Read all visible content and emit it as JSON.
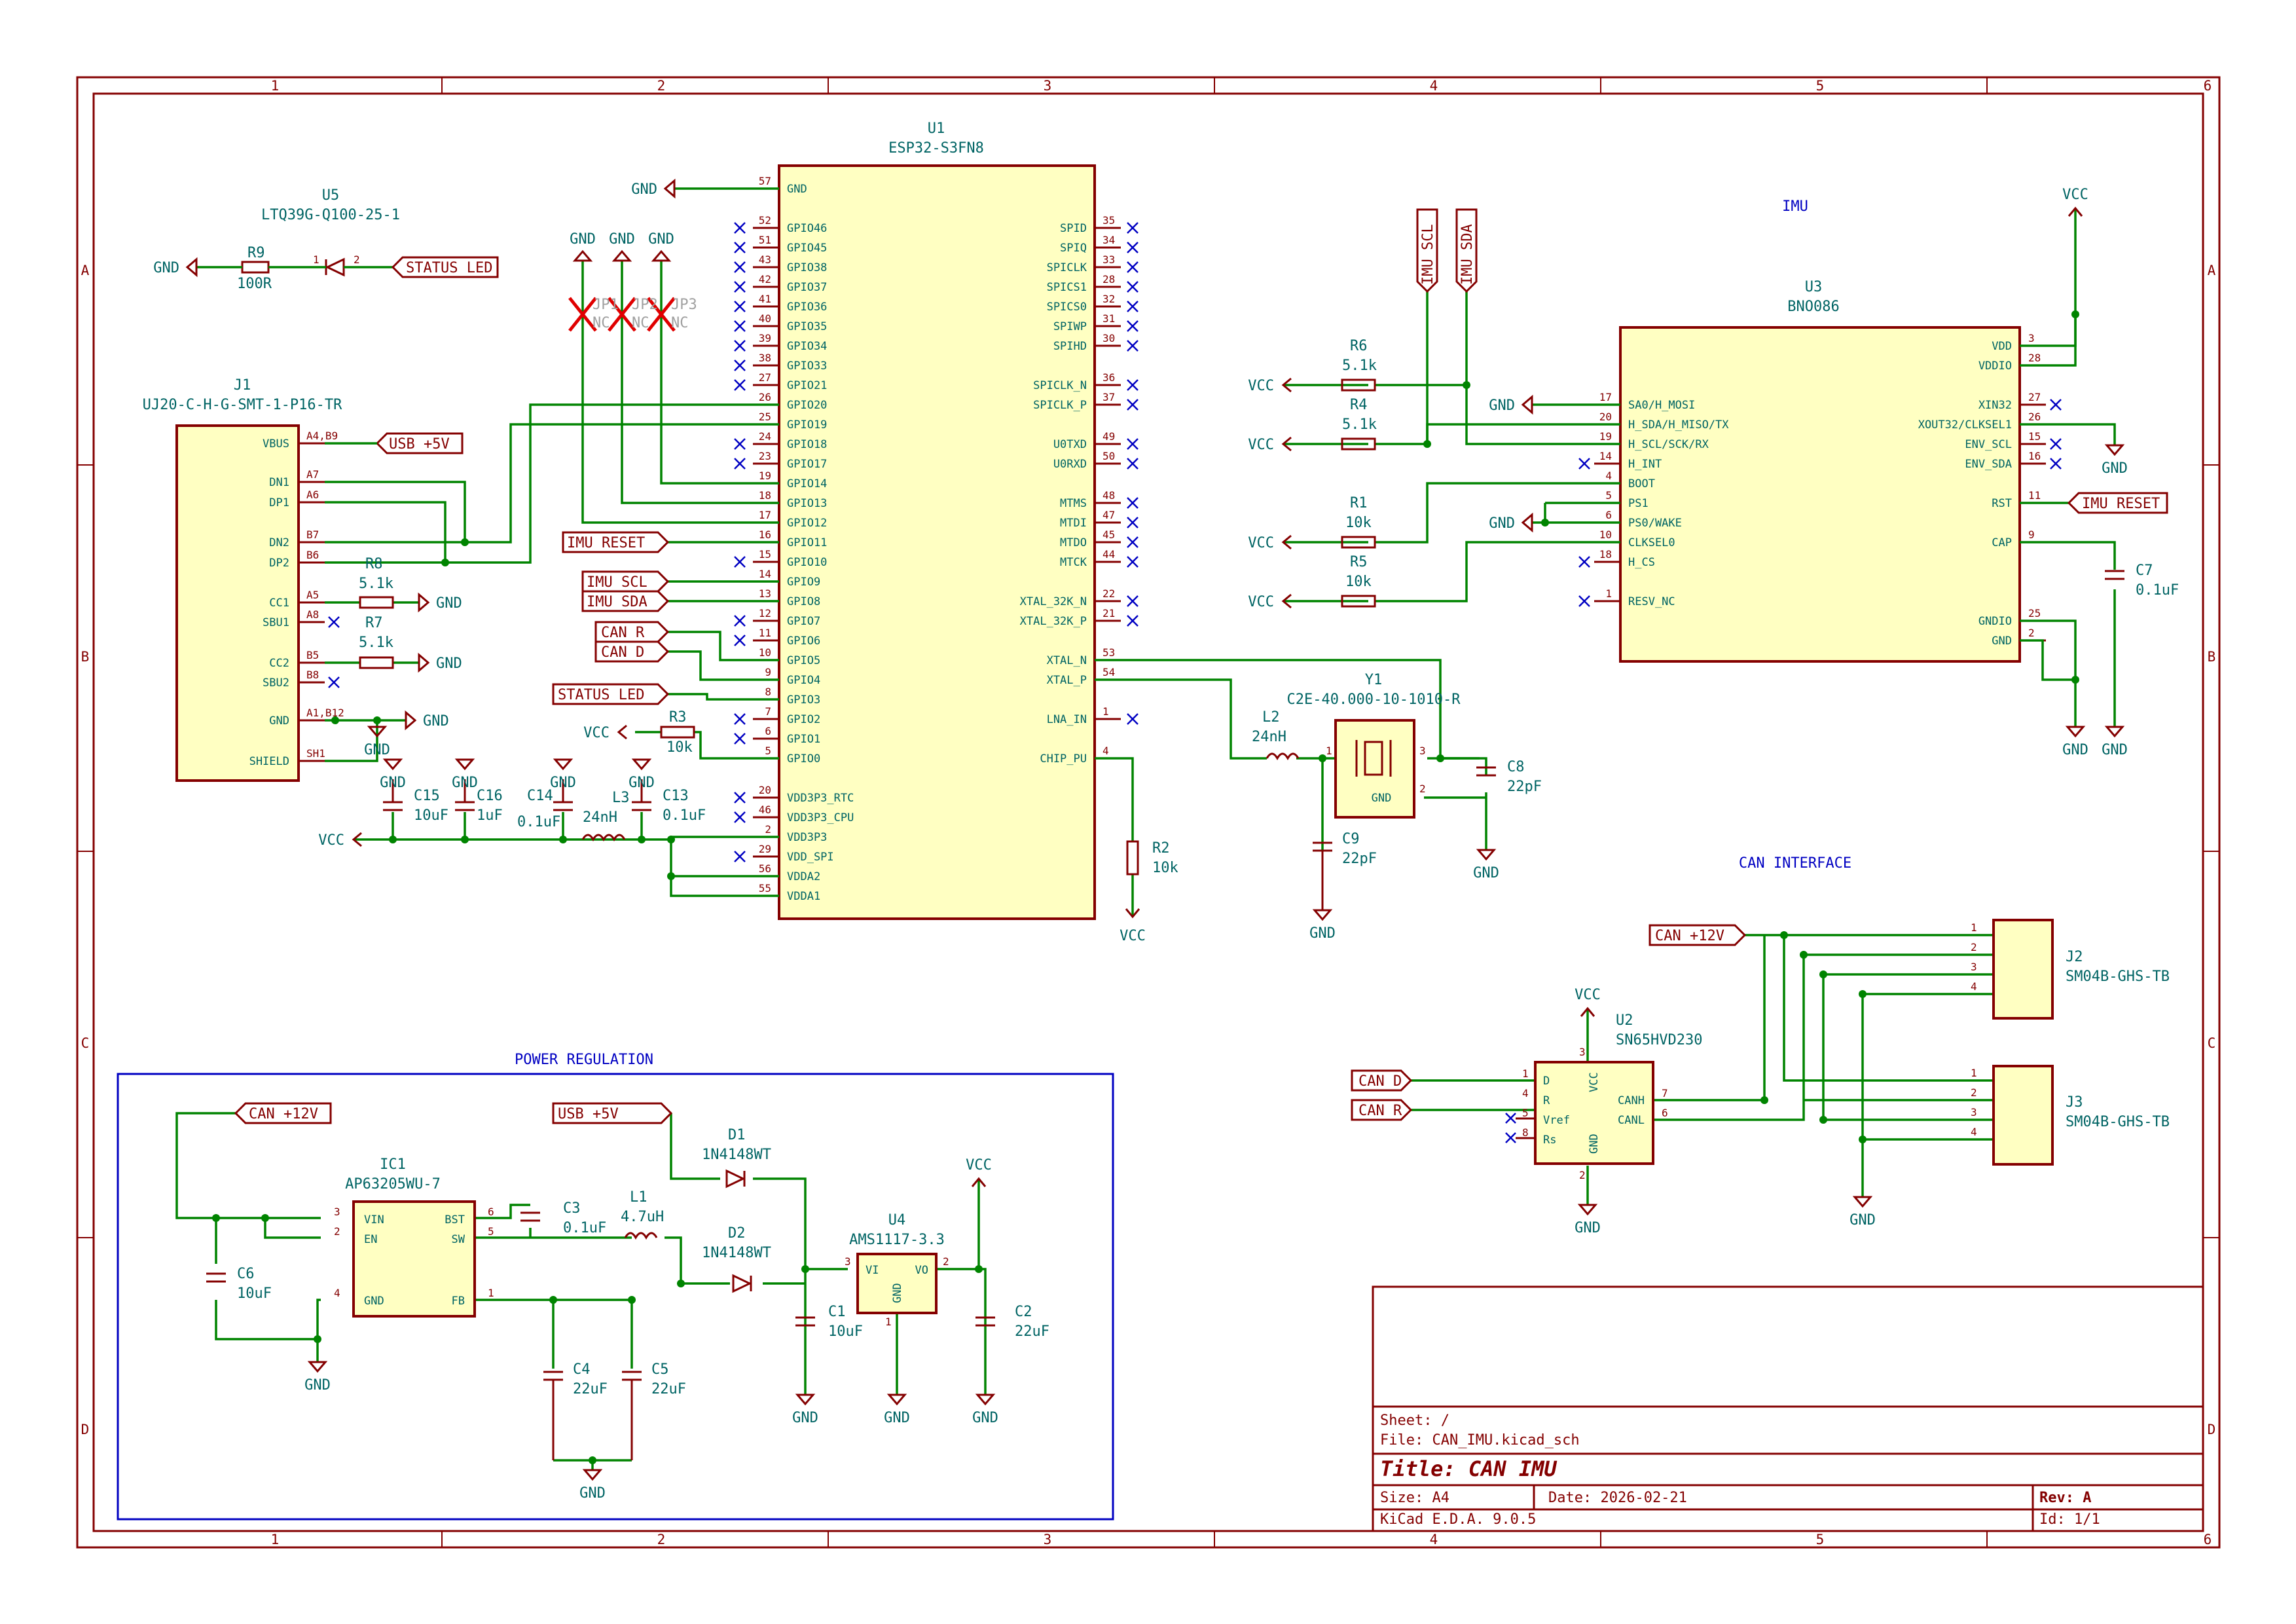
{
  "frame": {
    "columns": [
      "1",
      "2",
      "3",
      "4",
      "5",
      "6"
    ],
    "rows": [
      "A",
      "B",
      "C",
      "D"
    ]
  },
  "notes": {
    "imu": "IMU",
    "can": "CAN INTERFACE",
    "power": "POWER REGULATION"
  },
  "u1": {
    "ref": "U1",
    "value": "ESP32-S3FN8",
    "left_pins": [
      {
        "n": "57",
        "name": "GND"
      },
      {
        "n": "52",
        "name": "GPIO46"
      },
      {
        "n": "51",
        "name": "GPIO45"
      },
      {
        "n": "43",
        "name": "GPIO38"
      },
      {
        "n": "42",
        "name": "GPIO37"
      },
      {
        "n": "41",
        "name": "GPIO36"
      },
      {
        "n": "40",
        "name": "GPIO35"
      },
      {
        "n": "39",
        "name": "GPIO34"
      },
      {
        "n": "38",
        "name": "GPIO33"
      },
      {
        "n": "27",
        "name": "GPIO21"
      },
      {
        "n": "26",
        "name": "GPIO20"
      },
      {
        "n": "25",
        "name": "GPIO19"
      },
      {
        "n": "24",
        "name": "GPIO18"
      },
      {
        "n": "23",
        "name": "GPIO17"
      },
      {
        "n": "19",
        "name": "GPIO14"
      },
      {
        "n": "18",
        "name": "GPIO13"
      },
      {
        "n": "17",
        "name": "GPIO12"
      },
      {
        "n": "16",
        "name": "GPIO11"
      },
      {
        "n": "15",
        "name": "GPIO10"
      },
      {
        "n": "14",
        "name": "GPIO9"
      },
      {
        "n": "13",
        "name": "GPIO8"
      },
      {
        "n": "12",
        "name": "GPIO7"
      },
      {
        "n": "11",
        "name": "GPIO6"
      },
      {
        "n": "10",
        "name": "GPIO5"
      },
      {
        "n": "9",
        "name": "GPIO4"
      },
      {
        "n": "8",
        "name": "GPIO3"
      },
      {
        "n": "7",
        "name": "GPIO2"
      },
      {
        "n": "6",
        "name": "GPIO1"
      },
      {
        "n": "5",
        "name": "GPIO0"
      },
      {
        "n": "20",
        "name": "VDD3P3_RTC"
      },
      {
        "n": "46",
        "name": "VDD3P3_CPU"
      },
      {
        "n": "2",
        "name": "VDD3P3"
      },
      {
        "n": "29",
        "name": "VDD_SPI"
      },
      {
        "n": "56",
        "name": "VDDA2"
      },
      {
        "n": "55",
        "name": "VDDA1"
      }
    ],
    "right_pins": [
      {
        "n": "35",
        "name": "SPID"
      },
      {
        "n": "34",
        "name": "SPIQ"
      },
      {
        "n": "33",
        "name": "SPICLK"
      },
      {
        "n": "28",
        "name": "SPICS1"
      },
      {
        "n": "32",
        "name": "SPICS0"
      },
      {
        "n": "31",
        "name": "SPIWP"
      },
      {
        "n": "30",
        "name": "SPIHD"
      },
      {
        "n": "36",
        "name": "SPICLK_N"
      },
      {
        "n": "37",
        "name": "SPICLK_P"
      },
      {
        "n": "49",
        "name": "U0TXD"
      },
      {
        "n": "50",
        "name": "U0RXD"
      },
      {
        "n": "48",
        "name": "MTMS"
      },
      {
        "n": "47",
        "name": "MTDI"
      },
      {
        "n": "45",
        "name": "MTDO"
      },
      {
        "n": "44",
        "name": "MTCK"
      },
      {
        "n": "22",
        "name": "XTAL_32K_N"
      },
      {
        "n": "21",
        "name": "XTAL_32K_P"
      },
      {
        "n": "53",
        "name": "XTAL_N"
      },
      {
        "n": "54",
        "name": "XTAL_P"
      },
      {
        "n": "1",
        "name": "LNA_IN"
      },
      {
        "n": "4",
        "name": "CHIP_PU"
      }
    ]
  },
  "u3": {
    "ref": "U3",
    "value": "BNO086",
    "left_pins": [
      {
        "n": "17",
        "name": "SA0/H_MOSI"
      },
      {
        "n": "20",
        "name": "H_SDA/H_MISO/TX"
      },
      {
        "n": "19",
        "name": "H_SCL/SCK/RX"
      },
      {
        "n": "14",
        "name": "H_INT"
      },
      {
        "n": "4",
        "name": "BOOT"
      },
      {
        "n": "5",
        "name": "PS1"
      },
      {
        "n": "6",
        "name": "PS0/WAKE"
      },
      {
        "n": "10",
        "name": "CLKSEL0"
      },
      {
        "n": "18",
        "name": "H_CS"
      },
      {
        "n": "1",
        "name": "RESV_NC"
      }
    ],
    "right_pins": [
      {
        "n": "3",
        "name": "VDD"
      },
      {
        "n": "28",
        "name": "VDDIO"
      },
      {
        "n": "27",
        "name": "XIN32"
      },
      {
        "n": "26",
        "name": "XOUT32/CLKSEL1"
      },
      {
        "n": "15",
        "name": "ENV_SCL"
      },
      {
        "n": "16",
        "name": "ENV_SDA"
      },
      {
        "n": "11",
        "name": "RST"
      },
      {
        "n": "9",
        "name": "CAP"
      },
      {
        "n": "25",
        "name": "GNDIO"
      },
      {
        "n": "2",
        "name": "GND"
      }
    ]
  },
  "j1": {
    "ref": "J1",
    "value": "UJ20-C-H-G-SMT-1-P16-TR",
    "pins": [
      {
        "n": "A4,B9",
        "name": "VBUS"
      },
      {
        "n": "A7",
        "name": "DN1"
      },
      {
        "n": "A6",
        "name": "DP1"
      },
      {
        "n": "B7",
        "name": "DN2"
      },
      {
        "n": "B6",
        "name": "DP2"
      },
      {
        "n": "A5",
        "name": "CC1"
      },
      {
        "n": "A8",
        "name": "SBU1"
      },
      {
        "n": "B5",
        "name": "CC2"
      },
      {
        "n": "B8",
        "name": "SBU2"
      },
      {
        "n": "A1,B12",
        "name": "GND"
      },
      {
        "n": "SH1",
        "name": "SHIELD"
      }
    ]
  },
  "u2": {
    "ref": "U2",
    "value": "SN65HVD230",
    "pins_left": [
      {
        "n": "1",
        "name": "D"
      },
      {
        "n": "4",
        "name": "R"
      },
      {
        "n": "5",
        "name": "Vref"
      },
      {
        "n": "8",
        "name": "Rs"
      }
    ],
    "pins_right": [
      {
        "n": "7",
        "name": "CANH"
      },
      {
        "n": "6",
        "name": "CANL"
      }
    ],
    "vcc_pin": "3",
    "gnd_pin": "2",
    "vcc_name": "VCC",
    "gnd_name": "GND"
  },
  "ic1": {
    "ref": "IC1",
    "value": "AP63205WU-7",
    "pins_left": [
      {
        "n": "3",
        "name": "VIN"
      },
      {
        "n": "2",
        "name": "EN"
      },
      {
        "n": "4",
        "name": "GND"
      }
    ],
    "pins_right": [
      {
        "n": "6",
        "name": "BST"
      },
      {
        "n": "5",
        "name": "SW"
      },
      {
        "n": "1",
        "name": "FB"
      }
    ]
  },
  "u4": {
    "ref": "U4",
    "value": "AMS1117-3.3",
    "vi": "VI",
    "vo": "VO",
    "gnd": "GND",
    "p_vi": "3",
    "p_vo": "2",
    "p_gnd": "1"
  },
  "u5": {
    "ref": "U5",
    "value": "LTQ39G-Q100-25-1",
    "p1": "1",
    "p2": "2"
  },
  "y1": {
    "ref": "Y1",
    "value": "C2E-40.000-10-1010-R",
    "gnd": "GND",
    "p1": "1",
    "p2": "2",
    "p3": "3"
  },
  "j2": {
    "ref": "J2",
    "value": "SM04B-GHS-TB",
    "pins": [
      "1",
      "2",
      "3",
      "4"
    ]
  },
  "j3": {
    "ref": "J3",
    "value": "SM04B-GHS-TB",
    "pins": [
      "1",
      "2",
      "3",
      "4"
    ]
  },
  "passives": {
    "r9": {
      "ref": "R9",
      "value": "100R"
    },
    "r8": {
      "ref": "R8",
      "value": "5.1k"
    },
    "r7": {
      "ref": "R7",
      "value": "5.1k"
    },
    "r3": {
      "ref": "R3",
      "value": "10k"
    },
    "r2": {
      "ref": "R2",
      "value": "10k"
    },
    "r6": {
      "ref": "R6",
      "value": "5.1k"
    },
    "r4": {
      "ref": "R4",
      "value": "5.1k"
    },
    "r1": {
      "ref": "R1",
      "value": "10k"
    },
    "r5": {
      "ref": "R5",
      "value": "10k"
    },
    "c15": {
      "ref": "C15",
      "value": "10uF"
    },
    "c16": {
      "ref": "C16",
      "value": "1uF"
    },
    "c14": {
      "ref": "C14",
      "value": "0.1uF"
    },
    "c13": {
      "ref": "C13",
      "value": "0.1uF"
    },
    "l3": {
      "ref": "L3",
      "value": "24nH"
    },
    "l2": {
      "ref": "L2",
      "value": "24nH"
    },
    "c8": {
      "ref": "C8",
      "value": "22pF"
    },
    "c9": {
      "ref": "C9",
      "value": "22pF"
    },
    "c7": {
      "ref": "C7",
      "value": "0.1uF"
    },
    "c6": {
      "ref": "C6",
      "value": "10uF"
    },
    "c3": {
      "ref": "C3",
      "value": "0.1uF"
    },
    "l1": {
      "ref": "L1",
      "value": "4.7uH"
    },
    "c4": {
      "ref": "C4",
      "value": "22uF"
    },
    "c5": {
      "ref": "C5",
      "value": "22uF"
    },
    "c1": {
      "ref": "C1",
      "value": "10uF"
    },
    "c2": {
      "ref": "C2",
      "value": "22uF"
    },
    "d1": {
      "ref": "D1",
      "value": "1N4148WT"
    },
    "d2": {
      "ref": "D2",
      "value": "1N4148WT"
    },
    "jp1": {
      "ref": "JP1",
      "value": "NC"
    },
    "jp2": {
      "ref": "JP2",
      "value": "NC"
    },
    "jp3": {
      "ref": "JP3",
      "value": "NC"
    }
  },
  "labels": {
    "status_led": "STATUS LED",
    "usb5v": "USB +5V",
    "imu_reset": "IMU RESET",
    "imu_scl": "IMU SCL",
    "imu_sda": "IMU SDA",
    "can_r": "CAN R",
    "can_d": "CAN D",
    "can12v": "CAN +12V"
  },
  "power": {
    "gnd": "GND",
    "vcc": "VCC"
  },
  "title_block": {
    "sheet": "Sheet: /",
    "file": "File: CAN_IMU.kicad_sch",
    "title": "Title: CAN IMU",
    "size": "Size: A4",
    "date": "Date: 2026-02-21",
    "rev": "Rev: A",
    "tool": "KiCad E.D.A. 9.0.5",
    "id": "Id: 1/1"
  }
}
